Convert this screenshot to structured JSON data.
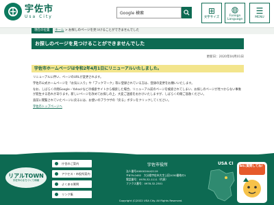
{
  "header": {
    "logo_main": "宇佐市",
    "logo_sub": "Usa City",
    "search_value": "Google 検索",
    "buttons": [
      {
        "label": "文字サイズ"
      },
      {
        "label": "Foreign Language"
      },
      {
        "label": "MENU"
      }
    ]
  },
  "breadcrumb": {
    "here_label": "現在の位置",
    "home": "ホーム",
    "separator": ">",
    "current": "お探しのページを見つけることができませんでした"
  },
  "main": {
    "title": "お探しのページを見つけることができませんでした",
    "date": "更新日：2020年04月01日",
    "notice": "宇佐市ホームページは令和2年4月1日にリニューアルいたしました。",
    "paragraphs": [
      "リニューアルに伴い、ページのURLが変更されます。",
      "宇佐市公式ホームページを「お気に入り」や「ブックマーク」等に登録されている方は、登録の変更をお願いいたします。",
      "なお、しばらくの間Google・Yahoo!などの検索サイトから検索した場合、リニューアル前のページを検索されてしまい、お探しのページが見つからない事象が発生する恐れがあります。新しいページを改めてお探しの上、大変ご迷惑をおかけいたしますが、しばらくの間ご容赦ください。",
      "直前に閲覧されていたページに戻るには、お使いのブラウザの「戻る」ボタンをクリックしてください。"
    ],
    "back_link": "宇佐市トップページへ"
  },
  "footer": {
    "realtown_title": "リアルTOWN",
    "realtown_sub": "宇佐市のまちづくり情報",
    "nav": [
      {
        "label": "庁舎のご案内"
      },
      {
        "label": "アクセス・市役所案内"
      },
      {
        "label": "よくある質問"
      },
      {
        "label": "リンク集"
      }
    ],
    "city_name": "宇佐市役所",
    "lines": [
      "法人番号4000020442119",
      "〒879-0492　大分県宇佐市大字上田1030番地の1",
      "電話番号：0978-32-1111（代表）",
      "ファクス番号：0978-32-2301"
    ],
    "copyright": "Copyright (C)2022 USA City. All Rights Reserved.",
    "usa_ci": "USA CI",
    "ai_badge": "AIに質問してね！"
  },
  "colors": {
    "brand_green": "#0d6a52",
    "notice_yellow": "#f3e58c"
  }
}
